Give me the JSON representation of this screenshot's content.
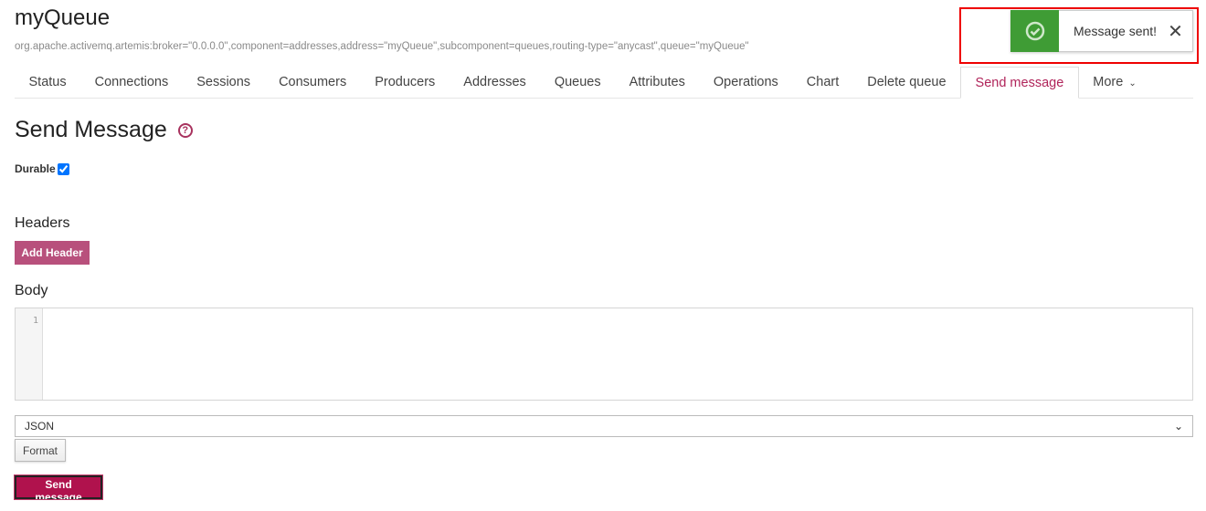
{
  "header": {
    "title": "myQueue",
    "mbean": "org.apache.activemq.artemis:broker=\"0.0.0.0\",component=addresses,address=\"myQueue\",subcomponent=queues,routing-type=\"anycast\",queue=\"myQueue\""
  },
  "tabs": [
    "Status",
    "Connections",
    "Sessions",
    "Consumers",
    "Producers",
    "Addresses",
    "Queues",
    "Attributes",
    "Operations",
    "Chart",
    "Delete queue",
    "Send message",
    "More"
  ],
  "active_tab": "Send message",
  "toast": {
    "message": "Message sent!",
    "icon": "check-circle-icon",
    "color": "#3f9c35"
  },
  "form": {
    "heading": "Send Message",
    "durable_label": "Durable",
    "durable_checked": true,
    "headers_label": "Headers",
    "add_header": "Add Header",
    "body_label": "Body",
    "line_number": "1",
    "format_selected": "JSON",
    "format_button": "Format",
    "send_button": "Send message"
  },
  "colors": {
    "accent": "#b0124d",
    "active_tab": "#b0245a"
  }
}
